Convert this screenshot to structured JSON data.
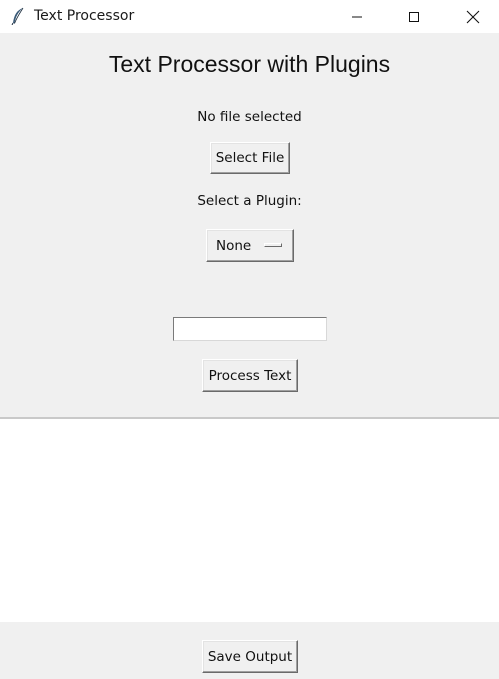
{
  "window": {
    "title": "Text Processor"
  },
  "header": {
    "title": "Text Processor with Plugins"
  },
  "file": {
    "status": "No file selected",
    "select_label": "Select File"
  },
  "plugin": {
    "label": "Select a Plugin:",
    "selected": "None"
  },
  "input": {
    "value": ""
  },
  "actions": {
    "process_label": "Process Text",
    "save_label": "Save Output"
  },
  "output": {
    "text": ""
  },
  "icons": {
    "app": "feather-icon",
    "minimize": "minimize-icon",
    "maximize": "maximize-icon",
    "close": "close-icon"
  }
}
